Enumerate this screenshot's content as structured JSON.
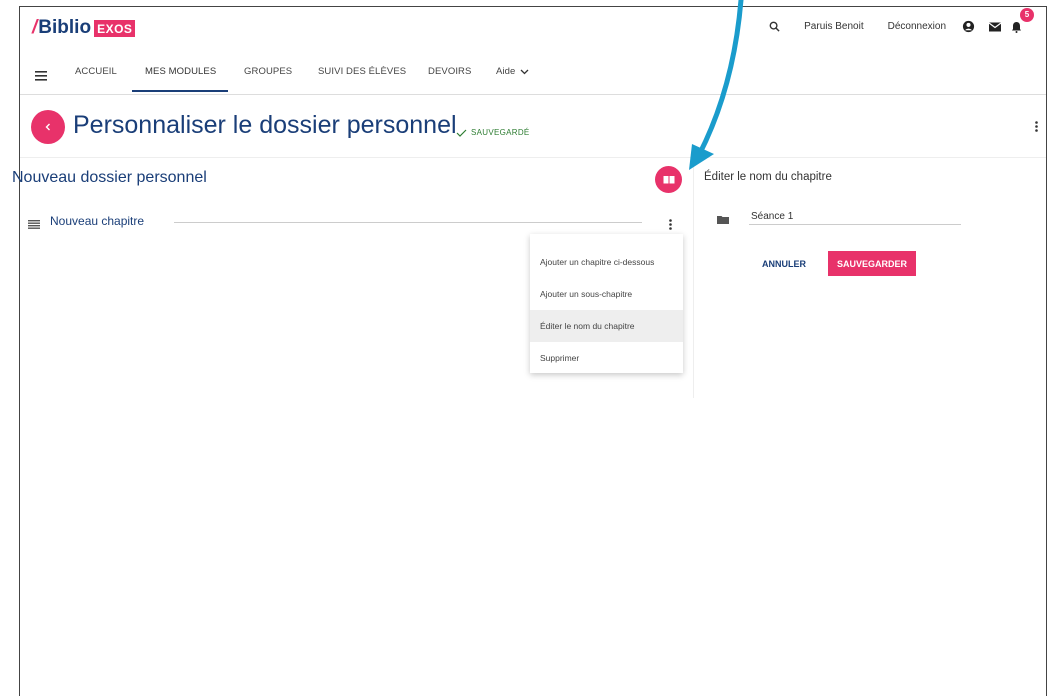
{
  "app": {
    "logo_text": "Biblio",
    "logo_badge": "EXOS",
    "logo_slash": "/"
  },
  "header": {
    "user_name": "Paruis Benoit",
    "logout_label": "Déconnexion",
    "notification_count": "5"
  },
  "nav": {
    "items": [
      {
        "label": "ACCUEIL"
      },
      {
        "label": "MES MODULES"
      },
      {
        "label": "GROUPES"
      },
      {
        "label": "SUIVI DES ÉLÈVES"
      },
      {
        "label": "DEVOIRS"
      },
      {
        "label": "Aide"
      }
    ]
  },
  "page": {
    "title": "Personnaliser le dossier personnel",
    "saved_status": "SAUVEGARDÉ"
  },
  "folder": {
    "title": "Nouveau dossier personnel",
    "chapter_label": "Nouveau chapitre"
  },
  "context_menu": {
    "items": [
      {
        "label": "Ajouter un chapitre ci-dessous"
      },
      {
        "label": "Ajouter un sous-chapitre"
      },
      {
        "label": "Éditer le nom du chapitre"
      },
      {
        "label": "Supprimer"
      }
    ]
  },
  "edit_panel": {
    "title": "Éditer le nom du chapitre",
    "input_value": "Séance 1",
    "cancel_label": "ANNULER",
    "save_label": "SAUVEGARDER"
  },
  "colors": {
    "brand_pink": "#e8326a",
    "brand_navy": "#1a3e78",
    "annotation_arrow": "#1a9ccc",
    "success_green": "#2e7d32"
  }
}
